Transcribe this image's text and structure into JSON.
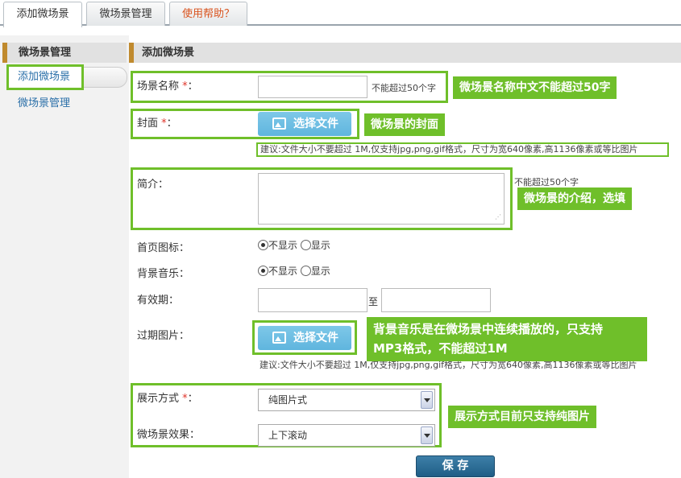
{
  "tabs": [
    {
      "label": "添加微场景"
    },
    {
      "label": "微场景管理"
    },
    {
      "label": "使用帮助？"
    }
  ],
  "sidebar": {
    "header": "微场景管理",
    "items": [
      {
        "label": "添加微场景"
      },
      {
        "label": "微场景管理"
      }
    ]
  },
  "main": {
    "header": "添加微场景"
  },
  "form": {
    "name": {
      "label": "场景名称",
      "required": "*",
      "colon": "：",
      "value": "",
      "hint": "不能超过50个字"
    },
    "cover": {
      "label": "封面",
      "required": "*",
      "colon": "：",
      "button": "选择文件",
      "hint": "建议:文件大小不要超过 1M,仅支持jpg,png,gif格式，尺寸为宽640像素,高1136像素或等比图片"
    },
    "intro": {
      "label": "简介：",
      "value": "",
      "hint": "不能超过50个字"
    },
    "homepage_icon": {
      "label": "首页图标：",
      "options": [
        "不显示",
        "显示"
      ],
      "selected": "不显示"
    },
    "bg_music": {
      "label": "背景音乐：",
      "options": [
        "不显示",
        "显示"
      ],
      "selected": "不显示"
    },
    "validity": {
      "label": "有效期：",
      "separator": "至",
      "start": "",
      "end": ""
    },
    "expired_image": {
      "label": "过期图片：",
      "button": "选择文件",
      "hint": "建议:文件大小不要超过 1M,仅支持jpg,png,gif格式，尺寸为宽640像素,高1136像素或等比图片"
    },
    "display_mode": {
      "label": "展示方式",
      "required": "*",
      "colon": "：",
      "selected": "纯图片式"
    },
    "effect": {
      "label": "微场景效果：",
      "selected": "上下滚动"
    },
    "save_label": "保 存"
  },
  "callouts": {
    "name": "微场景名称中文不能超过50字",
    "cover": "微场景的封面",
    "intro": "微场景的介绍，选填",
    "music_line1": "背景音乐是在微场景中连续播放的，只支持",
    "music_line2": "MP3格式，不能超过1M",
    "display": "展示方式目前只支持纯图片"
  },
  "colors": {
    "annotation_green": "#6fbf2a",
    "required_red": "#e0352b",
    "help_tab": "#d9531e",
    "link_blue": "#2a6fa8",
    "button_blue": "#5fb5de",
    "save_button": "#1f5e86"
  }
}
